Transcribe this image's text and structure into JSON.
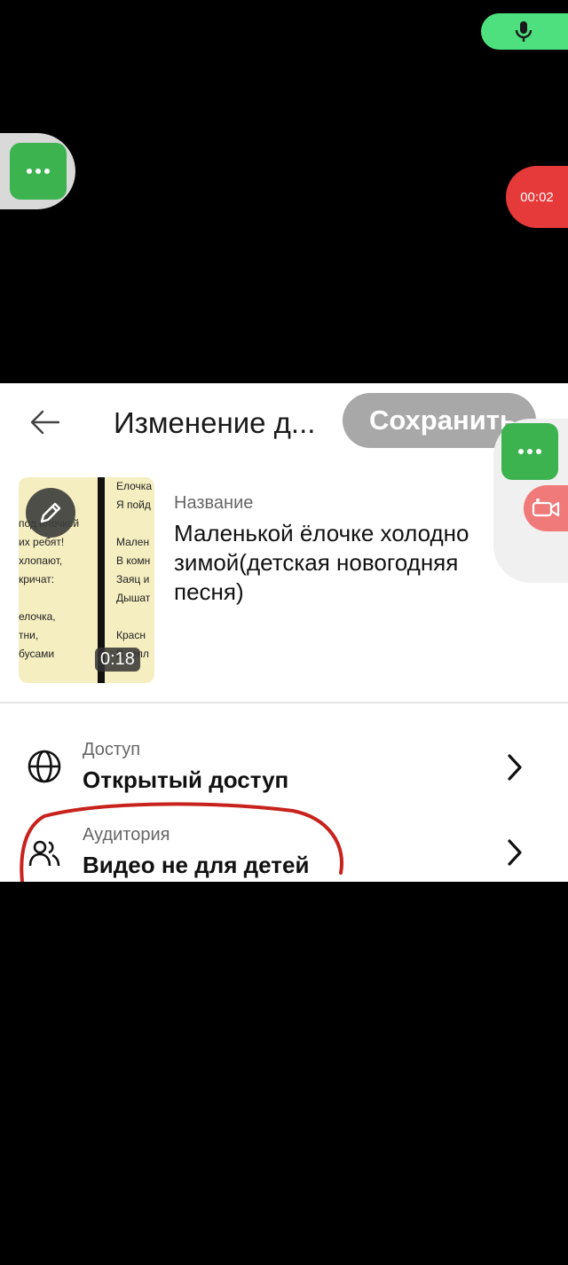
{
  "overlay": {
    "record_timer": "00:02",
    "mic_icon": "microphone-icon",
    "menu_icon": "more-dots-icon",
    "camera_icon": "camera-switch-icon",
    "colors": {
      "mic": "#4ee07e",
      "menu": "#3cb34f",
      "timer": "#e63939"
    }
  },
  "header": {
    "title": "Изменение д...",
    "save_label": "Сохранить",
    "back_icon": "arrow-left-icon"
  },
  "video": {
    "duration": "0:18",
    "edit_icon": "pencil-icon",
    "thumb_left_lines": [
      "",
      "",
      "под елочкой",
      "их ребят!",
      " хлопают,",
      "кричат:",
      "",
      "елочка,",
      "тни,",
      "бусами"
    ],
    "thumb_right_lines": [
      "Елочка",
      "Я пойд",
      "",
      "Мален",
      "В комн",
      "Заяц и",
      "Дышат",
      "",
      "Красн",
      "В тепл"
    ],
    "name_label": "Название",
    "name_value": "Маленькой ёлочке холодно зимой(детская новогодняя песня)"
  },
  "settings": [
    {
      "label": "Доступ",
      "value": "Открытый доступ",
      "icon": "globe-icon"
    },
    {
      "label": "Аудитория",
      "value": "Видео не для детей",
      "icon": "audience-icon"
    }
  ]
}
